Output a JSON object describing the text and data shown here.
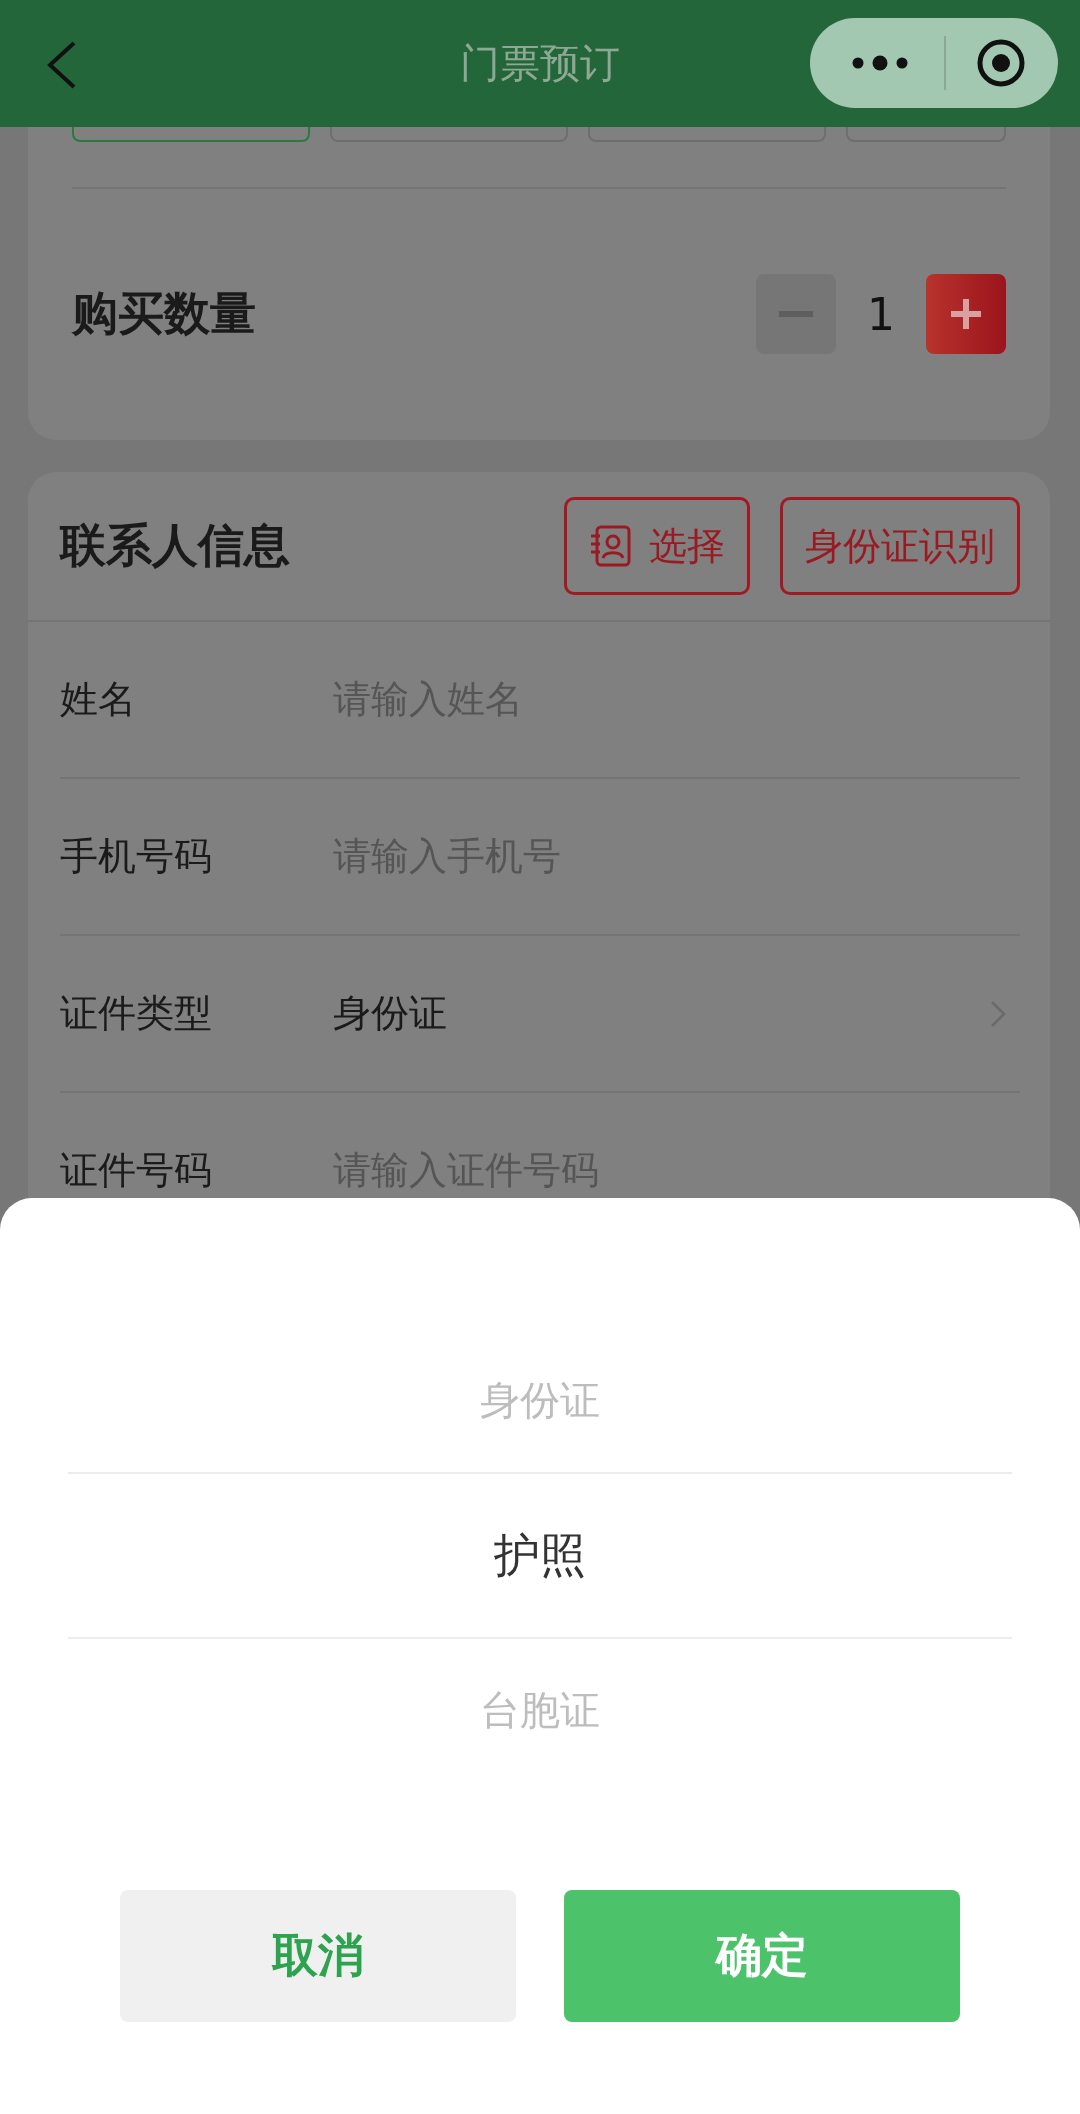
{
  "nav_bar": {
    "title": "门票预订"
  },
  "ticket_options": [
    {
      "selected": true
    },
    {
      "selected": false
    },
    {
      "selected": false
    },
    {
      "selected": false
    }
  ],
  "quantity": {
    "label": "购买数量",
    "value": "1"
  },
  "contact": {
    "title": "联系人信息",
    "buttons": [
      {
        "kind": "select",
        "label": "选择"
      },
      {
        "kind": "scan",
        "label": "身份证识别"
      }
    ],
    "fields": [
      {
        "kind": "input",
        "label": "姓名",
        "placeholder": "请输入姓名"
      },
      {
        "kind": "input",
        "label": "手机号码",
        "placeholder": "请输入手机号"
      },
      {
        "kind": "select",
        "label": "证件类型",
        "value": "身份证"
      },
      {
        "kind": "input",
        "label": "证件号码",
        "placeholder": "请输入证件号码"
      }
    ]
  },
  "picker": {
    "options": [
      {
        "label": "身份证",
        "selected": false
      },
      {
        "label": "护照",
        "selected": true
      },
      {
        "label": "台胞证",
        "selected": false
      }
    ],
    "cancel": "取消",
    "confirm": "确定"
  }
}
